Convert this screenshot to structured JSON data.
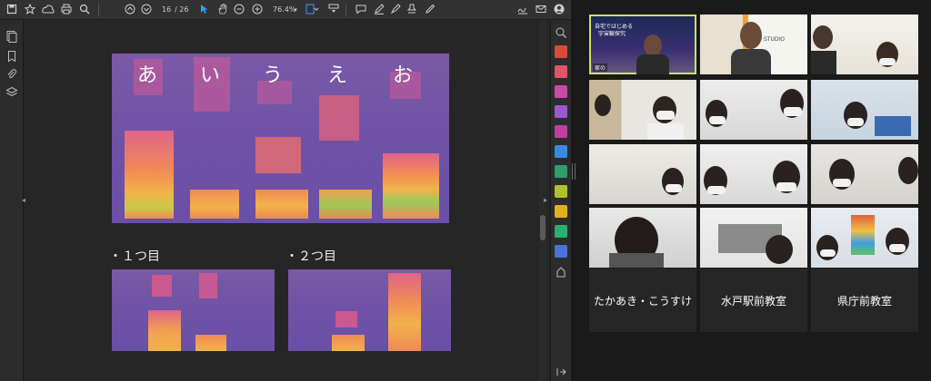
{
  "toolbar": {
    "page_current": "16",
    "page_total": "/ 26",
    "zoom": "76.4%"
  },
  "slide": {
    "vowels": [
      "あ",
      "い",
      "う",
      "え",
      "お"
    ],
    "caption_first": "・１つ目",
    "caption_second": "・２つ目"
  },
  "call": {
    "banner_line1": "自宅ではじめる",
    "banner_line2": "宇宙観探究",
    "studio_label": "STUDIO",
    "host_badge": "家の",
    "room_names": [
      "たかあき・こうすけ",
      "水戸駅前教室",
      "県庁前教室"
    ]
  },
  "colors": {
    "active_speaker": "#c9e26a",
    "spectrogram_bg": "#6f52a6",
    "spectrogram_hot": "#f0a040"
  }
}
